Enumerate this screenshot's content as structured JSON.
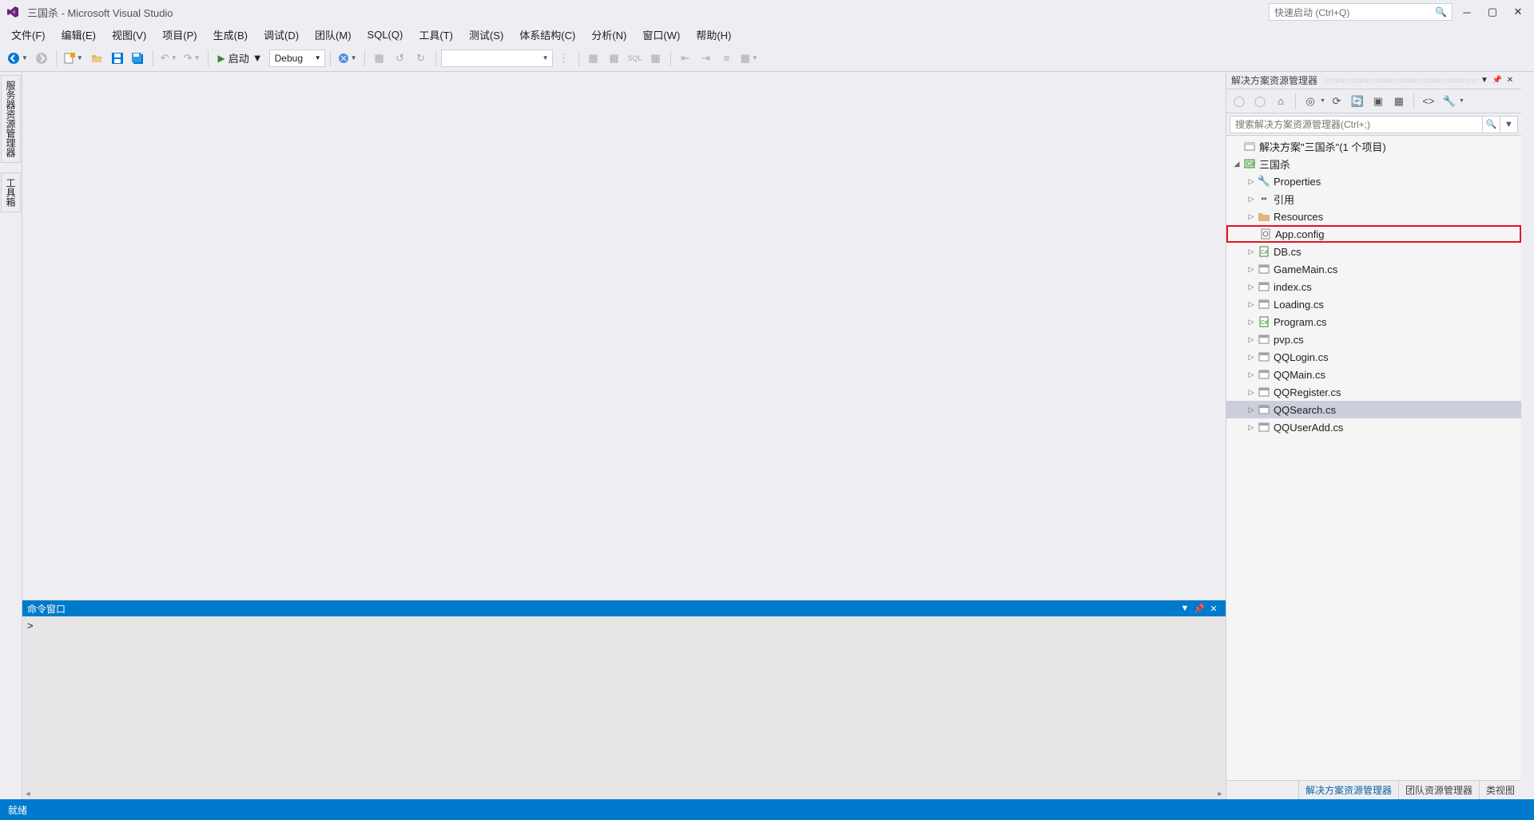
{
  "title": "三国杀 - Microsoft Visual Studio",
  "quick_launch_placeholder": "快速启动 (Ctrl+Q)",
  "menus": [
    "文件(F)",
    "编辑(E)",
    "视图(V)",
    "项目(P)",
    "生成(B)",
    "调试(D)",
    "团队(M)",
    "SQL(Q)",
    "工具(T)",
    "测试(S)",
    "体系结构(C)",
    "分析(N)",
    "窗口(W)",
    "帮助(H)"
  ],
  "toolbar": {
    "start_label": "启动",
    "config_label": "Debug"
  },
  "left_tabs": [
    "服务器资源管理器",
    "工具箱"
  ],
  "command_window": {
    "title": "命令窗口",
    "prompt": ">"
  },
  "solution_explorer": {
    "title": "解决方案资源管理器",
    "search_placeholder": "搜索解决方案资源管理器(Ctrl+;)",
    "solution_label": "解决方案\"三国杀\"(1 个项目)",
    "project": "三国杀",
    "nodes": [
      {
        "label": "Properties",
        "icon": "wrench",
        "expandable": true
      },
      {
        "label": "引用",
        "icon": "ref",
        "expandable": true
      },
      {
        "label": "Resources",
        "icon": "folder",
        "expandable": true
      },
      {
        "label": "App.config",
        "icon": "config",
        "expandable": false,
        "highlighted": true
      },
      {
        "label": "DB.cs",
        "icon": "cs-green",
        "expandable": true
      },
      {
        "label": "GameMain.cs",
        "icon": "form",
        "expandable": true
      },
      {
        "label": "index.cs",
        "icon": "form",
        "expandable": true
      },
      {
        "label": "Loading.cs",
        "icon": "form",
        "expandable": true
      },
      {
        "label": "Program.cs",
        "icon": "cs-green",
        "expandable": true
      },
      {
        "label": "pvp.cs",
        "icon": "form",
        "expandable": true
      },
      {
        "label": "QQLogin.cs",
        "icon": "form",
        "expandable": true
      },
      {
        "label": "QQMain.cs",
        "icon": "form",
        "expandable": true
      },
      {
        "label": "QQRegister.cs",
        "icon": "form",
        "expandable": true
      },
      {
        "label": "QQSearch.cs",
        "icon": "form",
        "expandable": true,
        "selected": true
      },
      {
        "label": "QQUserAdd.cs",
        "icon": "form",
        "expandable": true
      }
    ],
    "bottom_tabs": [
      "解决方案资源管理器",
      "团队资源管理器",
      "类视图"
    ]
  },
  "status": "就绪"
}
